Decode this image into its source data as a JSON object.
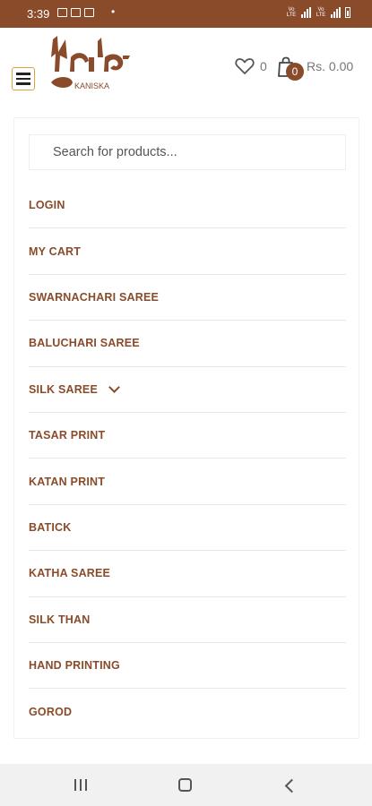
{
  "status_bar": {
    "time": "3:39",
    "dot": "•"
  },
  "header": {
    "logo_text": "KANISKA",
    "wishlist_count": "0",
    "cart_count": "0",
    "cart_total": "Rs. 0.00"
  },
  "search": {
    "placeholder": "Search for products..."
  },
  "menu": {
    "items": [
      {
        "label": "LOGIN"
      },
      {
        "label": "MY CART"
      },
      {
        "label": "SWARNACHARI SAREE"
      },
      {
        "label": "BALUCHARI SAREE"
      },
      {
        "label": "SILK SAREE"
      },
      {
        "label": "TASAR PRINT"
      },
      {
        "label": "KATAN PRINT"
      },
      {
        "label": "BATICK"
      },
      {
        "label": "KATHA SAREE"
      },
      {
        "label": "SILK THAN"
      },
      {
        "label": "HAND PRINTING"
      },
      {
        "label": "GOROD"
      }
    ]
  },
  "colors": {
    "brand": "#8a4b2b",
    "hamburger_border": "#d9a43b"
  },
  "icons": [
    "menu-icon",
    "heart-icon",
    "shopping-bag-icon",
    "chevron-down-icon",
    "recents-icon",
    "home-icon",
    "back-icon"
  ]
}
